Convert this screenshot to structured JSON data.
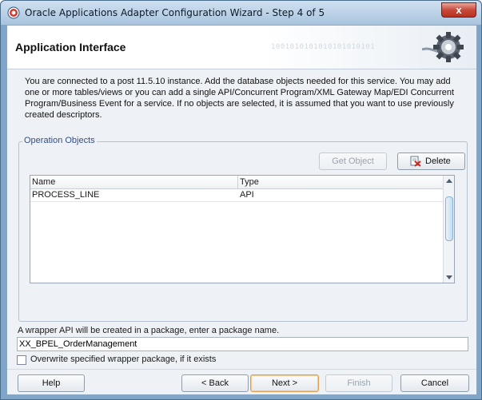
{
  "window": {
    "title": "Oracle Applications Adapter Configuration Wizard - Step 4 of 5",
    "close_label": "x"
  },
  "header": {
    "title": "Application Interface",
    "decoration_text": "1001010101010101010101"
  },
  "description": "You are connected to a post 11.5.10 instance. Add the database objects needed for this service. You may add one or more tables/views or you can add a single API/Concurrent Program/XML Gateway Map/EDI Concurrent Program/Business Event for a service. If no objects are selected, it is assumed that you want to use previously created descriptors.",
  "operation_objects": {
    "label": "Operation Objects",
    "get_object_label": "Get Object",
    "delete_label": "Delete",
    "columns": [
      "Name",
      "Type"
    ],
    "rows": [
      {
        "name": "PROCESS_LINE",
        "type": "API"
      }
    ]
  },
  "package": {
    "label": "A wrapper API will be created in a package, enter a package name.",
    "value": "XX_BPEL_OrderManagement",
    "overwrite_label": "Overwrite specified wrapper package, if it exists",
    "overwrite_checked": false
  },
  "footer": {
    "help_label": "Help",
    "back_label": "< Back",
    "next_label": "Next >",
    "finish_label": "Finish",
    "cancel_label": "Cancel"
  },
  "colors": {
    "window_frame": "#7fa6c9",
    "close_button": "#c9493a",
    "group_label": "#2f4f8f"
  }
}
